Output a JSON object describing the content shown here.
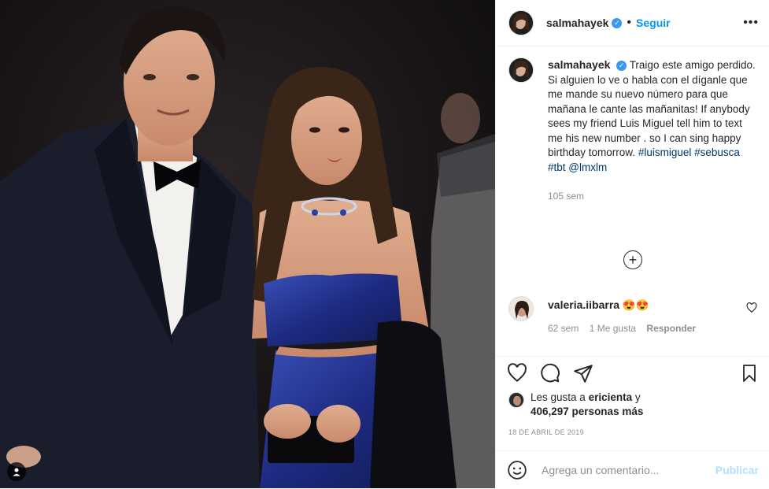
{
  "post": {
    "username": "salmahayek",
    "follow_label": "Seguir",
    "more_label": "•••",
    "caption_body": "Traigo este amigo perdido. Si alguien lo ve o habla con el díganle que me mande su nuevo número para que mañana le cante las mañanitas! If anybody sees my friend Luis Miguel tell him to text me his new number . so I can sing happy birthday tomorrow.",
    "hashtags": "#luismiguel #sebusca #tbt @lmxlm",
    "caption_age": "105 sem",
    "load_more_icon": "plus-circle-icon"
  },
  "comment": {
    "username": "valeria.iibarra",
    "text": "😍😍",
    "age": "62 sem",
    "likes": "1 Me gusta",
    "reply_label": "Responder"
  },
  "likes": {
    "prefix": "Les gusta a ",
    "first_user": "ericienta",
    "middle": " y",
    "count_text": "406,297 personas más"
  },
  "date": "18 DE ABRIL DE 2019",
  "add_comment": {
    "placeholder": "Agrega un comentario...",
    "publish_label": "Publicar"
  },
  "colors": {
    "accent": "#0095f6",
    "verified": "#3897f0",
    "dress": "#1c2a78"
  }
}
